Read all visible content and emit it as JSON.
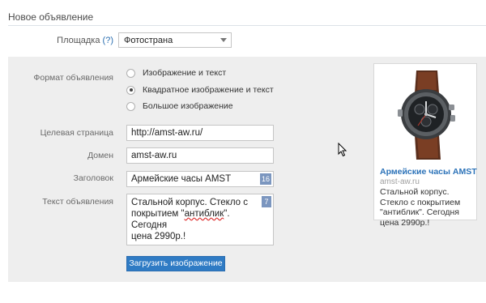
{
  "page": {
    "title": "Новое объявление"
  },
  "platform": {
    "label": "Площадка",
    "help": "(?)",
    "value": "Фотострана"
  },
  "ad_format": {
    "label": "Формат объявления",
    "options": [
      {
        "label": "Изображение и текст",
        "checked": false
      },
      {
        "label": "Квадратное изображение и текст",
        "checked": true
      },
      {
        "label": "Большое изображение",
        "checked": false
      }
    ]
  },
  "target_page": {
    "label": "Целевая страница",
    "value": "http://amst-aw.ru/"
  },
  "domain": {
    "label": "Домен",
    "value": "amst-aw.ru"
  },
  "headline": {
    "label": "Заголовок",
    "value": "Армейские часы AMST",
    "counter": "16"
  },
  "ad_text": {
    "label": "Текст объявления",
    "line1": "Стальной корпус. Стекло с",
    "line2_pre": "покрытием \"",
    "line2_spell": "антиблик",
    "line2_post": "\". Сегодня",
    "line3": "цена 2990р.!",
    "counter": "7"
  },
  "upload": {
    "label": "Загрузить изображение"
  },
  "preview": {
    "title": "Армейские часы AMST",
    "domain": "amst-aw.ru",
    "text": "Стальной корпус. Стекло с покрытием \"антиблик\". Сегодня цена 2990р.!"
  },
  "colors": {
    "accent": "#2f7bc4",
    "panel_bg": "#eeeeee",
    "badge": "#7b96bf",
    "link": "#2b72b8"
  }
}
